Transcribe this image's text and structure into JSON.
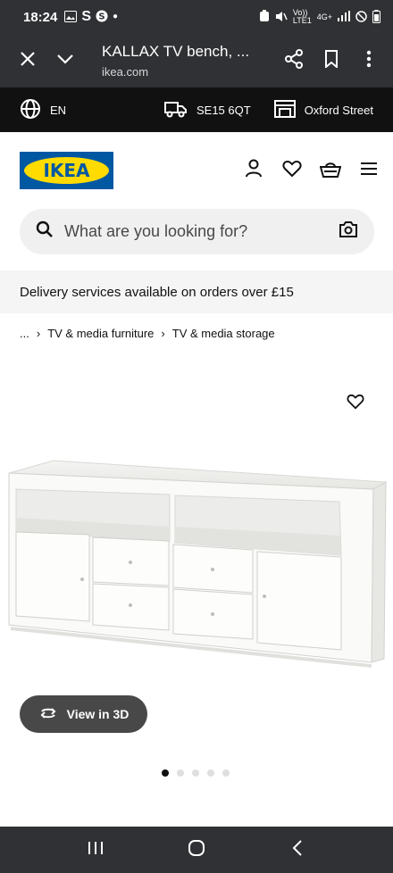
{
  "status_bar": {
    "time": "18:24",
    "network_label": "4G+",
    "lte_label": "LTE1",
    "volte_label": "Vo))"
  },
  "browser": {
    "tab_title": "KALLAX TV bench, ...",
    "domain": "ikea.com"
  },
  "topbar": {
    "language": "EN",
    "postcode": "SE15 6QT",
    "store": "Oxford Street"
  },
  "header": {
    "logo_text": "IKEA"
  },
  "search": {
    "placeholder": "What are you looking for?"
  },
  "delivery_banner": "Delivery services available on orders over £15",
  "breadcrumb": {
    "ellipsis": "...",
    "items": [
      "TV & media furniture",
      "TV & media storage"
    ]
  },
  "product": {
    "view_3d_label": "View in 3D",
    "image_count": 5,
    "active_image": 1
  },
  "colors": {
    "ikea_blue": "#0058a3",
    "ikea_yellow": "#ffdb00",
    "system_bar": "#303134",
    "topbar": "#111111"
  }
}
